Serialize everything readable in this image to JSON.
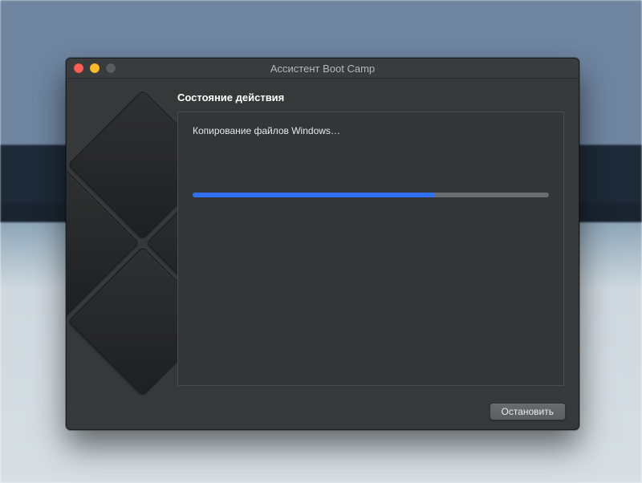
{
  "window": {
    "title": "Ассистент Boot Camp"
  },
  "section": {
    "heading": "Состояние действия",
    "status_message": "Копирование файлов Windows…"
  },
  "progress": {
    "percent": 68
  },
  "buttons": {
    "stop": "Остановить"
  },
  "colors": {
    "accent": "#2d6ff6",
    "window_bg": "#37383a"
  }
}
